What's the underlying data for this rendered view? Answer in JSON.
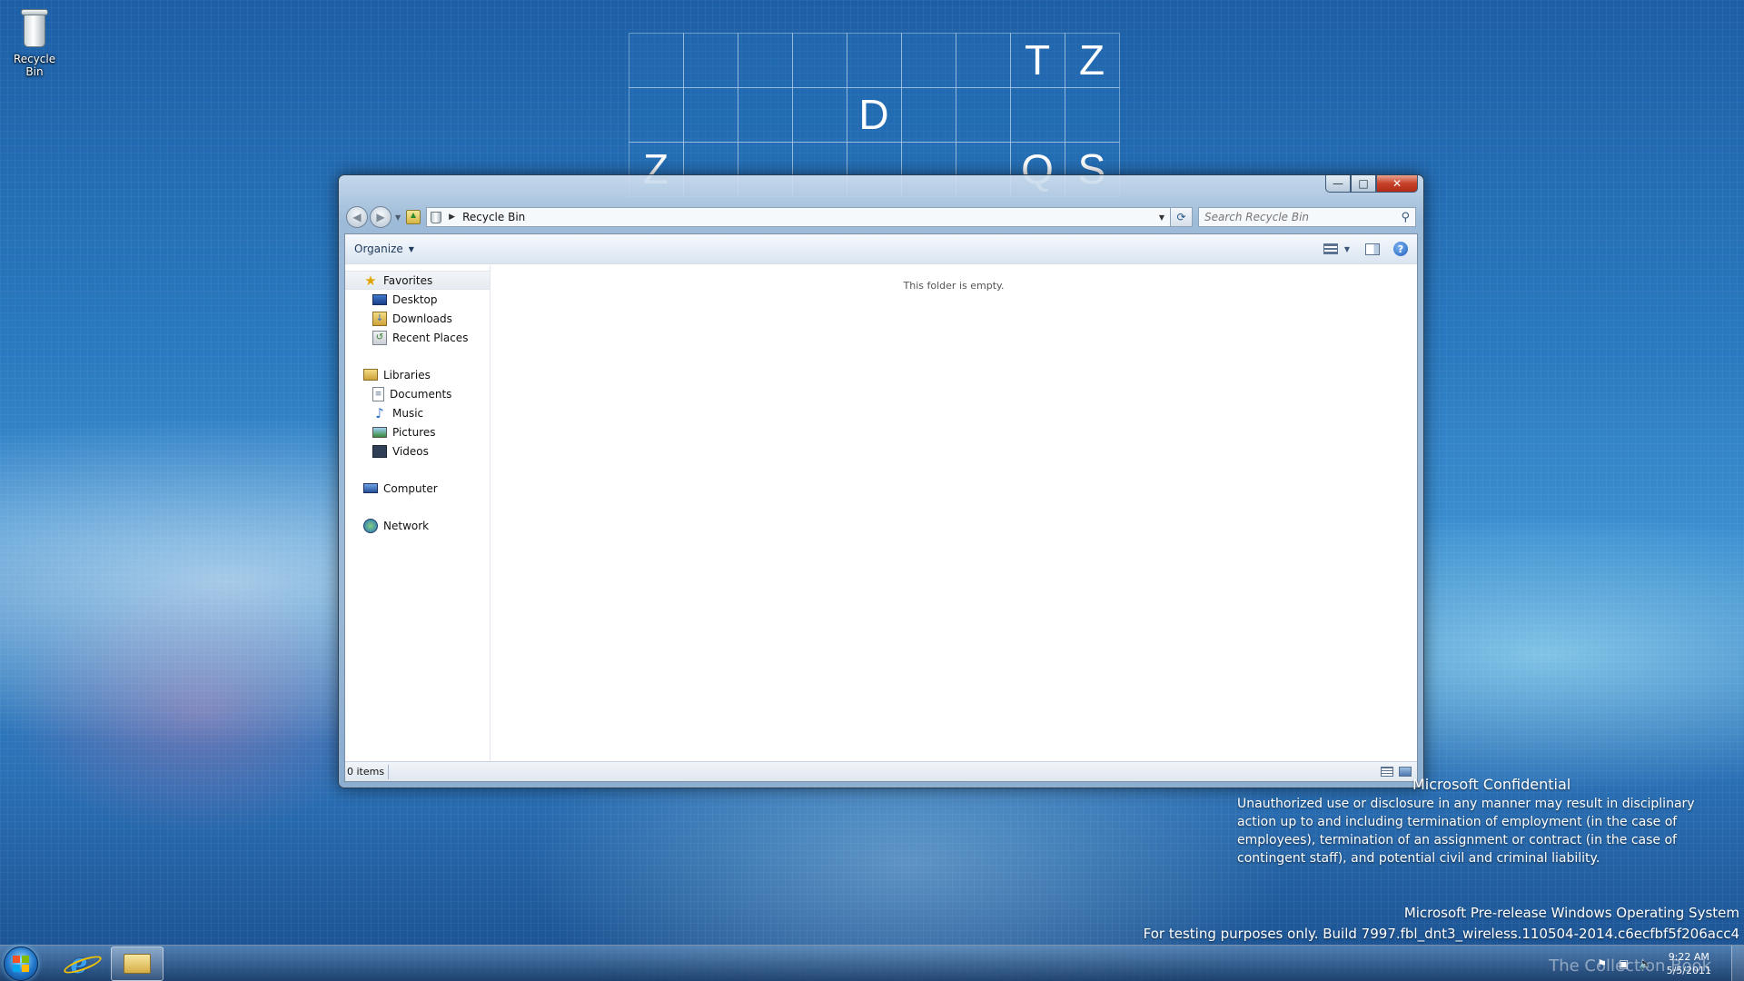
{
  "desktop": {
    "icons": [
      {
        "label": "Recycle Bin",
        "icon": "recycle-bin-icon"
      }
    ],
    "tiles": {
      "rows": [
        [
          "",
          "",
          "",
          "",
          "",
          "",
          "",
          "T",
          "Z"
        ],
        [
          "",
          "",
          "",
          "",
          "D",
          "",
          "",
          "",
          ""
        ],
        [
          "Z",
          "",
          "",
          "",
          "",
          "",
          "",
          "Q",
          "S"
        ]
      ]
    }
  },
  "window": {
    "caption_buttons": {
      "minimize": "—",
      "maximize": "□",
      "close": "✕"
    },
    "address": {
      "path": "Recycle Bin",
      "icon": "recycle-bin-icon"
    },
    "search": {
      "placeholder": "Search Recycle Bin"
    },
    "toolbar": {
      "organize_label": "Organize"
    },
    "nav_pane": {
      "groups": [
        {
          "label": "Favorites",
          "icon": "star-icon",
          "items": [
            {
              "label": "Desktop",
              "icon": "desktop-icon"
            },
            {
              "label": "Downloads",
              "icon": "downloads-icon"
            },
            {
              "label": "Recent Places",
              "icon": "recent-places-icon"
            }
          ]
        },
        {
          "label": "Libraries",
          "icon": "libraries-icon",
          "items": [
            {
              "label": "Documents",
              "icon": "documents-icon"
            },
            {
              "label": "Music",
              "icon": "music-icon"
            },
            {
              "label": "Pictures",
              "icon": "pictures-icon"
            },
            {
              "label": "Videos",
              "icon": "videos-icon"
            }
          ]
        },
        {
          "label": "Computer",
          "icon": "computer-icon",
          "items": []
        },
        {
          "label": "Network",
          "icon": "network-icon",
          "items": []
        }
      ]
    },
    "file_area": {
      "empty_message": "This folder is empty."
    },
    "status_bar": {
      "item_count": "0 items"
    }
  },
  "watermark": {
    "title": "Microsoft Confidential",
    "body": "Unauthorized use or disclosure in any manner may result in disciplinary action up to and including termination of employment (in the case of employees), termination of an assignment or contract (in the case of contingent staff), and potential civil and criminal liability.",
    "os_line": "Microsoft Pre-release Windows Operating System",
    "build_line": "For testing purposes only. Build 7997.fbl_dnt3_wireless.110504-2014.c6ecfbf5f206acc4"
  },
  "taskbar": {
    "clock": {
      "time": "9:22 AM",
      "date": "5/5/2011"
    },
    "overlay_text": "The Collection Book"
  },
  "colors": {
    "desktop_bg": "#2a79c0",
    "close_button": "#c7412a",
    "explorer_text": "#1e395b"
  }
}
